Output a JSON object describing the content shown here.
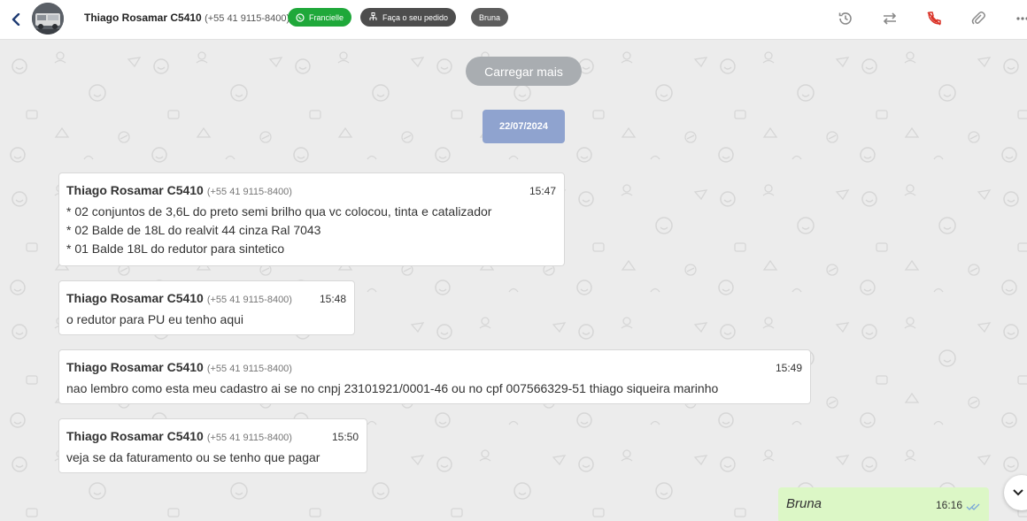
{
  "header": {
    "contact_name": "Thiago Rosamar C5410",
    "contact_phone": "(+55 41 9115-8400)",
    "tags": [
      {
        "label": "Francielle",
        "icon": "whatsapp-icon",
        "color": "#1fa83a"
      },
      {
        "label": "Faça o seu pedido",
        "icon": "flow-icon",
        "color": "#4d4d4d"
      },
      {
        "label": "Bruna",
        "color": "#5d5d5d"
      }
    ],
    "actions": [
      "history-icon",
      "transfer-icon",
      "end-call-icon",
      "attach-icon",
      "more-icon"
    ]
  },
  "chat": {
    "load_more_label": "Carregar mais",
    "date_label": "22/07/2024",
    "messages": [
      {
        "sender": "Thiago Rosamar C5410",
        "phone": "(+55 41 9115-8400)",
        "time": "15:47",
        "lines": [
          "* 02 conjuntos de 3,6L do preto semi brilho qua vc colocou, tinta e catalizador",
          "* 02 Balde de 18L do realvit 44 cinza Ral 7043",
          "* 01 Balde 18L do redutor para sintetico"
        ]
      },
      {
        "sender": "Thiago Rosamar C5410",
        "phone": "(+55 41 9115-8400)",
        "time": "15:48",
        "lines": [
          "o redutor para PU eu tenho aqui"
        ]
      },
      {
        "sender": "Thiago Rosamar C5410",
        "phone": "(+55 41 9115-8400)",
        "time": "15:49",
        "lines": [
          "nao lembro como esta meu cadastro ai se no cnpj 23101921/0001-46 ou no cpf 007566329-51 thiago siqueira marinho"
        ]
      },
      {
        "sender": "Thiago Rosamar C5410",
        "phone": "(+55 41 9115-8400)",
        "time": "15:50",
        "lines": [
          "veja se da faturamento ou se tenho que pagar"
        ]
      }
    ],
    "outgoing": {
      "sender": "Bruna",
      "time": "16:16"
    }
  },
  "colors": {
    "accent_green": "#1fa83a",
    "date_badge": "#8fa3cf",
    "outgoing_bubble": "#dcf7c6",
    "end_call_red": "#d93025"
  }
}
